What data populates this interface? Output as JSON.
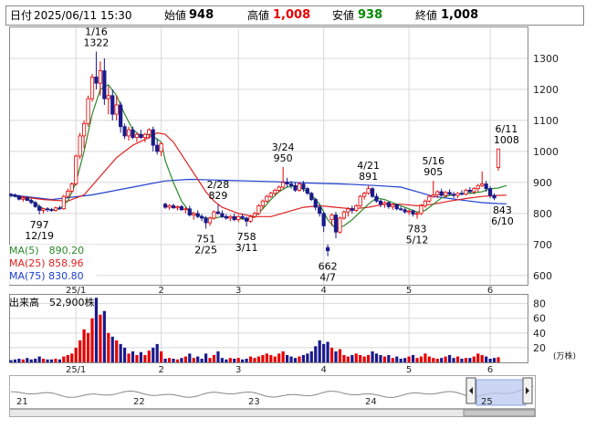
{
  "header": {
    "date_label": "日付",
    "date_value": "2025/06/11 15:30",
    "open_label": "始値",
    "open_value": "948",
    "high_label": "高値",
    "high_value": "1,008",
    "low_label": "安値",
    "low_value": "938",
    "close_label": "終値",
    "close_value": "1,008"
  },
  "legend": {
    "ma5": "MA(5)　890.20",
    "ma25": "MA(25) 858.96",
    "ma75": "MA(75) 830.80"
  },
  "volume": {
    "title": "出来高　52,900株",
    "unit": "(万株)"
  },
  "colors": {
    "up": "#e60000",
    "down": "#1a1a8c",
    "ma5": "#2a8a2a",
    "ma25": "#e02020",
    "ma75": "#2040d0"
  },
  "chart_data": {
    "type": "candlestick",
    "ylim": [
      570,
      1400
    ],
    "y_ticks": [
      600,
      700,
      800,
      900,
      1000,
      1100,
      1200,
      1300
    ],
    "volume_ticks": [
      20,
      40,
      60,
      80
    ],
    "volume_ylim": [
      0,
      92
    ],
    "x_labels": [
      {
        "label": "25/1",
        "idx": 16
      },
      {
        "label": "2",
        "idx": 37
      },
      {
        "label": "3",
        "idx": 56
      },
      {
        "label": "4",
        "idx": 77
      },
      {
        "label": "5",
        "idx": 98
      },
      {
        "label": "6",
        "idx": 118
      }
    ],
    "annotations": [
      {
        "idx": 7,
        "price": 797,
        "lines": [
          "797",
          "12/19"
        ],
        "pos": "below"
      },
      {
        "idx": 21,
        "price": 1322,
        "lines": [
          "1/16",
          "1322"
        ],
        "pos": "above"
      },
      {
        "idx": 48,
        "price": 751,
        "lines": [
          "751",
          "2/25"
        ],
        "pos": "below"
      },
      {
        "idx": 51,
        "price": 829,
        "lines": [
          "2/28",
          "829"
        ],
        "pos": "above"
      },
      {
        "idx": 58,
        "price": 758,
        "lines": [
          "758",
          "3/11"
        ],
        "pos": "below"
      },
      {
        "idx": 67,
        "price": 950,
        "lines": [
          "3/24",
          "950"
        ],
        "pos": "above"
      },
      {
        "idx": 78,
        "price": 662,
        "lines": [
          "662",
          "4/7"
        ],
        "pos": "below"
      },
      {
        "idx": 88,
        "price": 891,
        "lines": [
          "4/21",
          "891"
        ],
        "pos": "above"
      },
      {
        "idx": 100,
        "price": 783,
        "lines": [
          "783",
          "5/12"
        ],
        "pos": "below"
      },
      {
        "idx": 104,
        "price": 905,
        "lines": [
          "5/16",
          "905"
        ],
        "pos": "above"
      },
      {
        "idx": 121,
        "price": 843,
        "lines": [
          "843",
          "6/10"
        ],
        "pos": "below"
      },
      {
        "idx": 122,
        "price": 1008,
        "lines": [
          "6/11",
          "1008"
        ],
        "pos": "above"
      }
    ],
    "ohlc": [
      [
        862,
        866,
        852,
        858
      ],
      [
        860,
        864,
        852,
        855
      ],
      [
        856,
        860,
        842,
        846
      ],
      [
        846,
        852,
        838,
        850
      ],
      [
        850,
        854,
        840,
        842
      ],
      [
        842,
        848,
        830,
        835
      ],
      [
        835,
        840,
        818,
        822
      ],
      [
        822,
        828,
        797,
        810
      ],
      [
        810,
        818,
        800,
        815
      ],
      [
        815,
        820,
        805,
        812
      ],
      [
        812,
        818,
        806,
        810
      ],
      [
        810,
        822,
        806,
        818
      ],
      [
        818,
        825,
        812,
        815
      ],
      [
        815,
        860,
        812,
        855
      ],
      [
        855,
        880,
        850,
        872
      ],
      [
        872,
        900,
        865,
        895
      ],
      [
        895,
        990,
        890,
        985
      ],
      [
        985,
        1060,
        975,
        1050
      ],
      [
        1050,
        1100,
        1010,
        1090
      ],
      [
        1090,
        1180,
        1080,
        1170
      ],
      [
        1170,
        1250,
        1160,
        1240
      ],
      [
        1240,
        1322,
        1200,
        1220
      ],
      [
        1220,
        1290,
        1180,
        1260
      ],
      [
        1260,
        1300,
        1150,
        1170
      ],
      [
        1170,
        1210,
        1120,
        1180
      ],
      [
        1180,
        1200,
        1100,
        1120
      ],
      [
        1120,
        1180,
        1100,
        1150
      ],
      [
        1150,
        1160,
        1060,
        1080
      ],
      [
        1080,
        1090,
        1040,
        1050
      ],
      [
        1050,
        1080,
        1035,
        1070
      ],
      [
        1070,
        1080,
        1040,
        1045
      ],
      [
        1045,
        1060,
        1030,
        1055
      ],
      [
        1055,
        1070,
        1040,
        1045
      ],
      [
        1045,
        1060,
        1030,
        1055
      ],
      [
        1055,
        1075,
        1040,
        1070
      ],
      [
        1070,
        1080,
        1000,
        1020
      ],
      [
        1020,
        1040,
        990,
        1000
      ],
      [
        1000,
        1030,
        985,
        1025
      ],
      [
        830,
        835,
        815,
        820
      ],
      [
        820,
        830,
        812,
        825
      ],
      [
        825,
        832,
        815,
        818
      ],
      [
        818,
        826,
        810,
        822
      ],
      [
        822,
        828,
        808,
        812
      ],
      [
        812,
        820,
        800,
        815
      ],
      [
        815,
        825,
        790,
        795
      ],
      [
        795,
        805,
        780,
        800
      ],
      [
        800,
        810,
        785,
        790
      ],
      [
        790,
        798,
        775,
        785
      ],
      [
        785,
        792,
        751,
        770
      ],
      [
        770,
        790,
        760,
        785
      ],
      [
        785,
        810,
        780,
        805
      ],
      [
        805,
        829,
        795,
        800
      ],
      [
        800,
        810,
        785,
        790
      ],
      [
        790,
        798,
        780,
        785
      ],
      [
        785,
        795,
        775,
        790
      ],
      [
        790,
        800,
        775,
        780
      ],
      [
        780,
        795,
        772,
        790
      ],
      [
        790,
        798,
        780,
        785
      ],
      [
        785,
        790,
        758,
        775
      ],
      [
        775,
        795,
        770,
        790
      ],
      [
        790,
        805,
        785,
        800
      ],
      [
        800,
        830,
        795,
        825
      ],
      [
        825,
        845,
        815,
        840
      ],
      [
        840,
        860,
        835,
        855
      ],
      [
        855,
        870,
        850,
        865
      ],
      [
        865,
        880,
        858,
        875
      ],
      [
        875,
        890,
        868,
        885
      ],
      [
        885,
        950,
        880,
        900
      ],
      [
        900,
        915,
        885,
        895
      ],
      [
        895,
        905,
        880,
        890
      ],
      [
        890,
        900,
        870,
        875
      ],
      [
        875,
        900,
        870,
        895
      ],
      [
        895,
        905,
        870,
        880
      ],
      [
        880,
        885,
        860,
        865
      ],
      [
        865,
        870,
        840,
        845
      ],
      [
        845,
        850,
        810,
        820
      ],
      [
        820,
        830,
        790,
        800
      ],
      [
        800,
        805,
        740,
        760
      ],
      [
        690,
        700,
        662,
        680
      ],
      [
        780,
        800,
        760,
        795
      ],
      [
        795,
        805,
        720,
        740
      ],
      [
        740,
        790,
        735,
        785
      ],
      [
        785,
        810,
        780,
        805
      ],
      [
        805,
        820,
        790,
        815
      ],
      [
        815,
        825,
        800,
        810
      ],
      [
        810,
        830,
        805,
        825
      ],
      [
        825,
        860,
        820,
        855
      ],
      [
        855,
        870,
        845,
        865
      ],
      [
        865,
        891,
        860,
        880
      ],
      [
        880,
        885,
        850,
        855
      ],
      [
        855,
        865,
        835,
        840
      ],
      [
        840,
        845,
        820,
        830
      ],
      [
        830,
        840,
        818,
        835
      ],
      [
        835,
        838,
        815,
        822
      ],
      [
        822,
        830,
        812,
        828
      ],
      [
        828,
        832,
        810,
        815
      ],
      [
        815,
        822,
        808,
        812
      ],
      [
        812,
        818,
        800,
        805
      ],
      [
        805,
        812,
        795,
        808
      ],
      [
        808,
        812,
        790,
        798
      ],
      [
        798,
        805,
        783,
        800
      ],
      [
        800,
        830,
        795,
        825
      ],
      [
        825,
        845,
        818,
        840
      ],
      [
        840,
        860,
        835,
        855
      ],
      [
        855,
        905,
        850,
        860
      ],
      [
        860,
        875,
        850,
        870
      ],
      [
        870,
        880,
        855,
        858
      ],
      [
        858,
        872,
        852,
        868
      ],
      [
        868,
        878,
        858,
        862
      ],
      [
        862,
        870,
        850,
        858
      ],
      [
        858,
        868,
        850,
        865
      ],
      [
        865,
        875,
        858,
        862
      ],
      [
        862,
        880,
        858,
        875
      ],
      [
        875,
        885,
        865,
        870
      ],
      [
        870,
        885,
        862,
        880
      ],
      [
        880,
        895,
        870,
        890
      ],
      [
        890,
        935,
        885,
        895
      ],
      [
        895,
        905,
        870,
        880
      ],
      [
        880,
        888,
        850,
        858
      ],
      [
        858,
        865,
        843,
        850
      ],
      [
        948,
        1008,
        938,
        1008
      ]
    ],
    "ma5": [
      [
        0,
        858
      ],
      [
        5,
        842
      ],
      [
        8,
        815
      ],
      [
        10,
        812
      ],
      [
        12,
        815
      ],
      [
        14,
        840
      ],
      [
        16,
        900
      ],
      [
        18,
        1000
      ],
      [
        20,
        1120
      ],
      [
        22,
        1200
      ],
      [
        24,
        1215
      ],
      [
        26,
        1180
      ],
      [
        28,
        1120
      ],
      [
        30,
        1070
      ],
      [
        32,
        1050
      ],
      [
        34,
        1055
      ],
      [
        36,
        1040
      ],
      [
        37,
        1030
      ],
      [
        38,
        970
      ],
      [
        40,
        900
      ],
      [
        42,
        840
      ],
      [
        44,
        805
      ],
      [
        46,
        795
      ],
      [
        48,
        785
      ],
      [
        50,
        785
      ],
      [
        52,
        790
      ],
      [
        54,
        788
      ],
      [
        56,
        785
      ],
      [
        58,
        780
      ],
      [
        60,
        790
      ],
      [
        62,
        815
      ],
      [
        64,
        845
      ],
      [
        66,
        870
      ],
      [
        68,
        885
      ],
      [
        70,
        890
      ],
      [
        72,
        878
      ],
      [
        74,
        860
      ],
      [
        76,
        830
      ],
      [
        78,
        780
      ],
      [
        80,
        750
      ],
      [
        82,
        760
      ],
      [
        84,
        780
      ],
      [
        86,
        805
      ],
      [
        88,
        830
      ],
      [
        90,
        850
      ],
      [
        92,
        845
      ],
      [
        94,
        835
      ],
      [
        96,
        825
      ],
      [
        98,
        815
      ],
      [
        100,
        805
      ],
      [
        102,
        810
      ],
      [
        104,
        830
      ],
      [
        106,
        850
      ],
      [
        108,
        858
      ],
      [
        110,
        862
      ],
      [
        112,
        864
      ],
      [
        114,
        866
      ],
      [
        116,
        870
      ],
      [
        118,
        880
      ],
      [
        120,
        882
      ],
      [
        122,
        890
      ]
    ],
    "ma25": [
      [
        0,
        858
      ],
      [
        8,
        845
      ],
      [
        14,
        840
      ],
      [
        18,
        860
      ],
      [
        22,
        920
      ],
      [
        26,
        980
      ],
      [
        30,
        1020
      ],
      [
        34,
        1045
      ],
      [
        36,
        1060
      ],
      [
        38,
        1055
      ],
      [
        40,
        1030
      ],
      [
        42,
        990
      ],
      [
        44,
        950
      ],
      [
        46,
        910
      ],
      [
        48,
        870
      ],
      [
        50,
        840
      ],
      [
        52,
        820
      ],
      [
        56,
        800
      ],
      [
        60,
        790
      ],
      [
        64,
        790
      ],
      [
        68,
        805
      ],
      [
        72,
        820
      ],
      [
        76,
        825
      ],
      [
        80,
        820
      ],
      [
        84,
        815
      ],
      [
        88,
        820
      ],
      [
        92,
        830
      ],
      [
        96,
        830
      ],
      [
        100,
        825
      ],
      [
        104,
        830
      ],
      [
        108,
        840
      ],
      [
        112,
        848
      ],
      [
        116,
        855
      ],
      [
        120,
        858
      ],
      [
        122,
        859
      ]
    ],
    "ma75": [
      [
        0,
        860
      ],
      [
        10,
        845
      ],
      [
        20,
        860
      ],
      [
        30,
        885
      ],
      [
        38,
        905
      ],
      [
        44,
        910
      ],
      [
        50,
        908
      ],
      [
        58,
        905
      ],
      [
        66,
        902
      ],
      [
        74,
        898
      ],
      [
        82,
        895
      ],
      [
        90,
        890
      ],
      [
        96,
        885
      ],
      [
        100,
        870
      ],
      [
        104,
        855
      ],
      [
        110,
        845
      ],
      [
        116,
        835
      ],
      [
        120,
        832
      ],
      [
        122,
        831
      ]
    ],
    "volume": [
      3,
      4,
      5,
      4,
      6,
      4,
      5,
      8,
      5,
      4,
      4,
      5,
      4,
      8,
      10,
      12,
      20,
      30,
      45,
      40,
      60,
      88,
      65,
      70,
      40,
      35,
      30,
      25,
      20,
      12,
      15,
      10,
      14,
      10,
      16,
      20,
      25,
      15,
      5,
      6,
      5,
      4,
      6,
      8,
      12,
      6,
      8,
      5,
      12,
      6,
      10,
      15,
      6,
      4,
      6,
      5,
      6,
      4,
      5,
      8,
      6,
      8,
      10,
      12,
      10,
      8,
      12,
      15,
      10,
      8,
      6,
      8,
      10,
      12,
      15,
      22,
      30,
      25,
      28,
      20,
      15,
      18,
      10,
      8,
      10,
      12,
      10,
      8,
      10,
      15,
      12,
      10,
      8,
      10,
      6,
      8,
      5,
      6,
      8,
      10,
      6,
      8,
      12,
      8,
      6,
      5,
      6,
      8,
      10,
      6,
      8,
      5,
      6,
      6,
      8,
      12,
      10,
      8,
      5,
      6,
      7
    ],
    "mini_labels": [
      {
        "label": "21",
        "x": 18
      },
      {
        "label": "22",
        "x": 146
      },
      {
        "label": "23",
        "x": 272
      },
      {
        "label": "24",
        "x": 400
      },
      {
        "label": "25",
        "x": 527
      }
    ]
  }
}
